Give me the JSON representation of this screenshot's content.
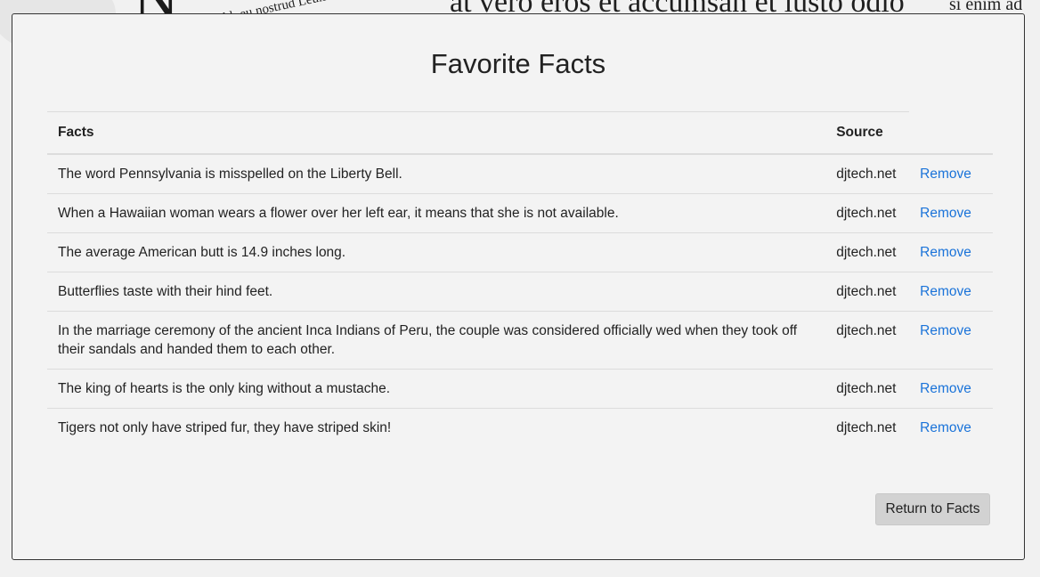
{
  "background": {
    "headline_text": "at vero eros et accumsan et iusto odio",
    "small_text_left": "nibh eu nostrud Leum facilisis",
    "small_text_right": "si enim ad"
  },
  "page": {
    "title": "Favorite Facts"
  },
  "table": {
    "headers": {
      "facts": "Facts",
      "source": "Source"
    },
    "rows": [
      {
        "fact": "The word Pennsylvania is misspelled on the Liberty Bell.",
        "source": "djtech.net",
        "action": "Remove"
      },
      {
        "fact": "When a Hawaiian woman wears a flower over her left ear, it means that she is not available.",
        "source": "djtech.net",
        "action": "Remove"
      },
      {
        "fact": "The average American butt is 14.9 inches long.",
        "source": "djtech.net",
        "action": "Remove"
      },
      {
        "fact": "Butterflies taste with their hind feet.",
        "source": "djtech.net",
        "action": "Remove"
      },
      {
        "fact": "In the marriage ceremony of the ancient Inca Indians of Peru, the couple was considered officially wed when they took off their sandals and handed them to each other.",
        "source": "djtech.net",
        "action": "Remove"
      },
      {
        "fact": "The king of hearts is the only king without a mustache.",
        "source": "djtech.net",
        "action": "Remove"
      },
      {
        "fact": "Tigers not only have striped fur, they have striped skin!",
        "source": "djtech.net",
        "action": "Remove"
      }
    ]
  },
  "footer": {
    "return_label": "Return to Facts"
  },
  "colors": {
    "link": "#1a73d9",
    "button_bg": "#d2d2d2",
    "panel_bg": "#f3f3f3"
  }
}
